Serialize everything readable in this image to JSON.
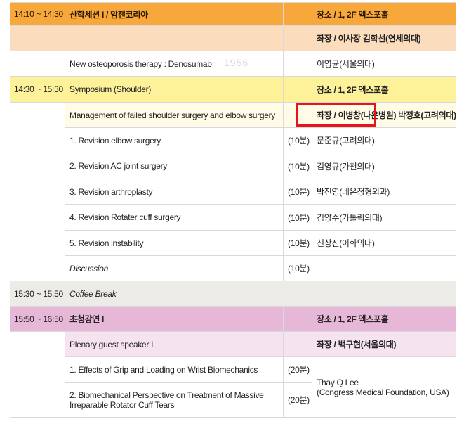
{
  "rows": {
    "s1_header": {
      "time": "14:10 ~ 14:30",
      "title": "산학세션 I / 암젠코리아",
      "speaker": "장소 / 1, 2F 엑스포홀"
    },
    "s1_chair": {
      "speaker": "좌장 / 이사장 김학선(연세의대)"
    },
    "s1_talk": {
      "title": "New osteoporosis therapy : Denosumab",
      "speaker": "이영균(서울의대)"
    },
    "s2_header": {
      "time": "14:30 ~ 15:30",
      "title": "Symposium (Shoulder)",
      "speaker": "장소 / 1, 2F 엑스포홀"
    },
    "s2_chair": {
      "title": "Management of failed shoulder surgery and elbow surgery",
      "speaker_a": "좌장 / 이병창(나은병원)",
      "speaker_b": "박정호(고려의대)"
    },
    "s2_talks": [
      {
        "title": "1. Revision elbow surgery",
        "dur": "(10분)",
        "speaker": "문준규(고려의대)"
      },
      {
        "title": "2. Revision AC joint surgery",
        "dur": "(10분)",
        "speaker": "김영규(가천의대)"
      },
      {
        "title": "3. Revision arthroplasty",
        "dur": "(10분)",
        "speaker": "박진영(네온정형외과)"
      },
      {
        "title": "4. Revision Rotater cuff surgery",
        "dur": "(10분)",
        "speaker": "김양수(가톨릭의대)"
      },
      {
        "title": "5. Revision instability",
        "dur": "(10분)",
        "speaker": "신상진(이화의대)"
      }
    ],
    "s2_discussion": {
      "title": "Discussion",
      "dur": "(10분)"
    },
    "coffee": {
      "time": "15:30 ~ 15:50",
      "title": "Coffee Break"
    },
    "s3_header": {
      "time": "15:50 ~ 16:50",
      "title": "초청강연 I",
      "speaker": "장소 / 1, 2F 엑스포홀"
    },
    "s3_chair": {
      "title": "Plenary guest speaker I",
      "speaker": "좌장 / 백구현(서울의대)"
    },
    "s3_talks": [
      {
        "title": "1. Effects of Grip and Loading on Wrist Biomechanics",
        "dur": "(20분)"
      },
      {
        "title": "2. Biomechanical Perspective on Treatment of Massive Irreparable Rotator Cuff Tears",
        "dur": "(20분)"
      }
    ],
    "s3_speaker": {
      "name": "Thay Q Lee",
      "affil": "(Congress Medical Foundation, USA)"
    }
  },
  "watermark": "1956",
  "colors": {
    "orange": "#f8a73a",
    "peach": "#fbdcbc",
    "yellow": "#fdf19a",
    "pink": "#e7b7d8",
    "highlight_box": "#e8141b"
  }
}
